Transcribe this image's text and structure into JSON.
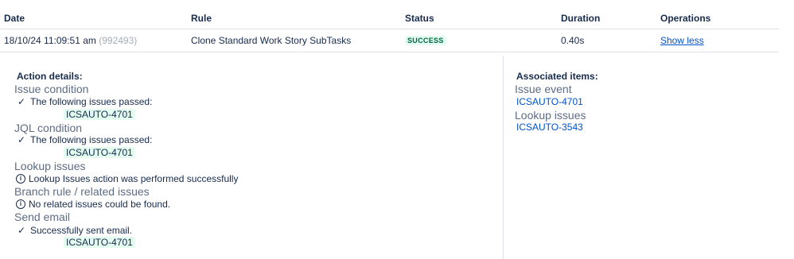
{
  "table": {
    "headers": {
      "date": "Date",
      "rule": "Rule",
      "status": "Status",
      "duration": "Duration",
      "operations": "Operations"
    },
    "row": {
      "date": "18/10/24 11:09:51 am",
      "id": "(992493)",
      "rule": "Clone Standard Work Story SubTasks",
      "status": "SUCCESS",
      "duration": "0.40s",
      "operation_link": "Show less"
    }
  },
  "action_details": {
    "title": "Action details:",
    "conditions": [
      {
        "title": "Issue condition",
        "message": "The following issues passed:",
        "icon": "check-icon",
        "issue": "ICSAUTO-4701"
      },
      {
        "title": "JQL condition",
        "message": "The following issues passed:",
        "icon": "check-icon",
        "issue": "ICSAUTO-4701"
      },
      {
        "title": "Lookup issues",
        "message": "Lookup Issues action was performed successfully",
        "icon": "info-icon"
      },
      {
        "title": "Branch rule / related issues",
        "message": "No related issues could be found.",
        "icon": "info-icon"
      },
      {
        "title": "Send email",
        "message": "Successfully sent email.",
        "icon": "check-icon",
        "issue": "ICSAUTO-4701"
      }
    ]
  },
  "associated_items": {
    "title": "Associated items:",
    "groups": [
      {
        "title": "Issue event",
        "link": "ICSAUTO-4701"
      },
      {
        "title": "Lookup issues",
        "link": "ICSAUTO-3543"
      }
    ]
  },
  "colors": {
    "success_bg": "#e3fcef",
    "success_text": "#006644",
    "link": "#0052cc",
    "divider": "#dfe1e6"
  }
}
